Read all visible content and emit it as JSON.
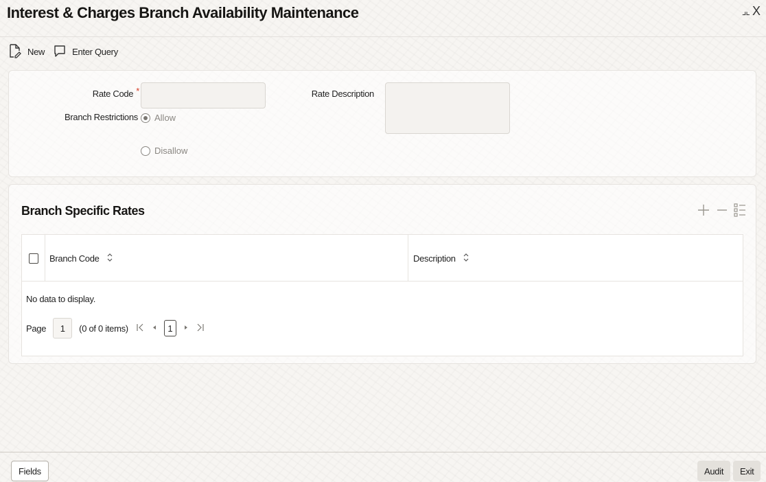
{
  "window": {
    "title": "Interest & Charges Branch Availability Maintenance",
    "restore_glyph": "⌟⌞",
    "close_glyph": "X"
  },
  "toolbar": {
    "new_label": "New",
    "enter_query_label": "Enter Query"
  },
  "form": {
    "rate_code_label": "Rate Code",
    "rate_code_required": "*",
    "rate_code_value": "",
    "rate_description_label": "Rate Description",
    "rate_description_value": "",
    "branch_restrictions_label": "Branch Restrictions",
    "options": {
      "allow": "Allow",
      "disallow": "Disallow"
    },
    "selected_option": "Allow"
  },
  "branch_rates": {
    "title": "Branch Specific Rates",
    "columns": [
      "Branch Code",
      "Description"
    ],
    "rows": [],
    "empty_text": "No data to display.",
    "pager": {
      "page_label": "Page",
      "page_value": "1",
      "items_text": "(0 of 0 items)",
      "current_page": "1"
    }
  },
  "footer": {
    "fields_label": "Fields",
    "audit_label": "Audit",
    "exit_label": "Exit"
  },
  "colors": {
    "required": "#d63b25",
    "text": "#1f1f1f",
    "muted": "#8a8782"
  }
}
